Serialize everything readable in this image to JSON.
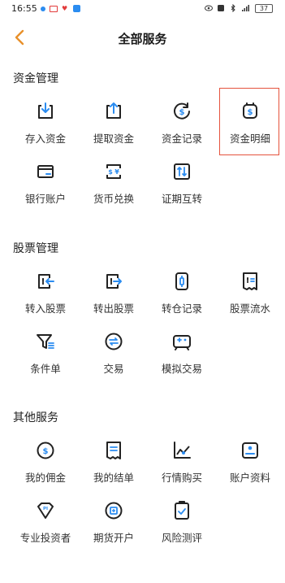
{
  "status_bar": {
    "time": "16:55",
    "battery": "37"
  },
  "header": {
    "title": "全部服务"
  },
  "sections": [
    {
      "title": "资金管理",
      "items": [
        {
          "label": "存入资金",
          "icon": "deposit-icon"
        },
        {
          "label": "提取资金",
          "icon": "withdraw-icon"
        },
        {
          "label": "资金记录",
          "icon": "fund-record-icon"
        },
        {
          "label": "资金明细",
          "icon": "fund-detail-icon"
        },
        {
          "label": "银行账户",
          "icon": "bank-card-icon"
        },
        {
          "label": "货币兑换",
          "icon": "currency-exchange-icon"
        },
        {
          "label": "证期互转",
          "icon": "transfer-icon"
        }
      ]
    },
    {
      "title": "股票管理",
      "items": [
        {
          "label": "转入股票",
          "icon": "stock-in-icon"
        },
        {
          "label": "转出股票",
          "icon": "stock-out-icon"
        },
        {
          "label": "转仓记录",
          "icon": "transfer-record-icon"
        },
        {
          "label": "股票流水",
          "icon": "stock-flow-icon"
        },
        {
          "label": "条件单",
          "icon": "filter-icon"
        },
        {
          "label": "交易",
          "icon": "trade-icon"
        },
        {
          "label": "模拟交易",
          "icon": "simulated-trade-icon"
        }
      ]
    },
    {
      "title": "其他服务",
      "items": [
        {
          "label": "我的佣金",
          "icon": "commission-icon"
        },
        {
          "label": "我的结单",
          "icon": "statement-icon"
        },
        {
          "label": "行情购买",
          "icon": "market-data-icon"
        },
        {
          "label": "账户资料",
          "icon": "account-info-icon"
        },
        {
          "label": "专业投资者",
          "icon": "pro-investor-icon"
        },
        {
          "label": "期货开户",
          "icon": "futures-account-icon"
        },
        {
          "label": "风险测评",
          "icon": "risk-assessment-icon"
        }
      ]
    }
  ],
  "colors": {
    "accent": "#e8902a",
    "highlight": "#e5533d",
    "icon": "#222222"
  }
}
